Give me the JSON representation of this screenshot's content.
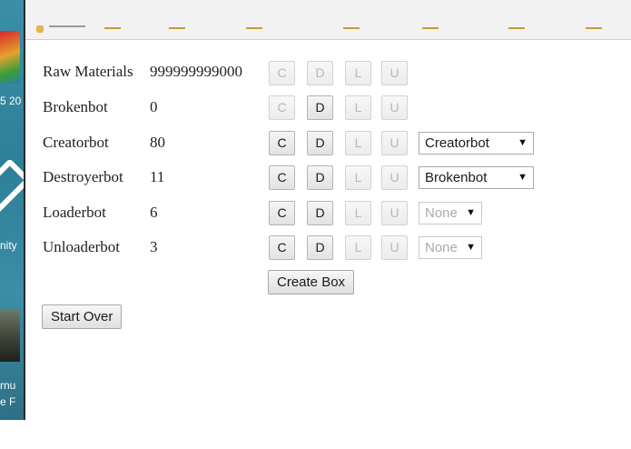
{
  "left_strip": {
    "fragments": [
      "5 20",
      "nity",
      "rnu",
      "e F"
    ]
  },
  "bots": [
    {
      "name": "Raw Materials",
      "count": "999999999000",
      "buttons": [
        "C",
        "D",
        "L",
        "U"
      ]
    },
    {
      "name": "Brokenbot",
      "count": "0",
      "buttons": [
        "C",
        "D",
        "L",
        "U"
      ]
    },
    {
      "name": "Creatorbot",
      "count": "80",
      "buttons": [
        "C",
        "D",
        "L",
        "U"
      ],
      "select": "Creatorbot"
    },
    {
      "name": "Destroyerbot",
      "count": "11",
      "buttons": [
        "C",
        "D",
        "L",
        "U"
      ],
      "select": "Brokenbot"
    },
    {
      "name": "Loaderbot",
      "count": "6",
      "buttons": [
        "C",
        "D",
        "L",
        "U"
      ],
      "select": "None"
    },
    {
      "name": "Unloaderbot",
      "count": "3",
      "buttons": [
        "C",
        "D",
        "L",
        "U"
      ],
      "select": "None"
    }
  ],
  "actions": {
    "create_box": "Create Box",
    "start_over": "Start Over"
  },
  "select_arrow": "▼"
}
